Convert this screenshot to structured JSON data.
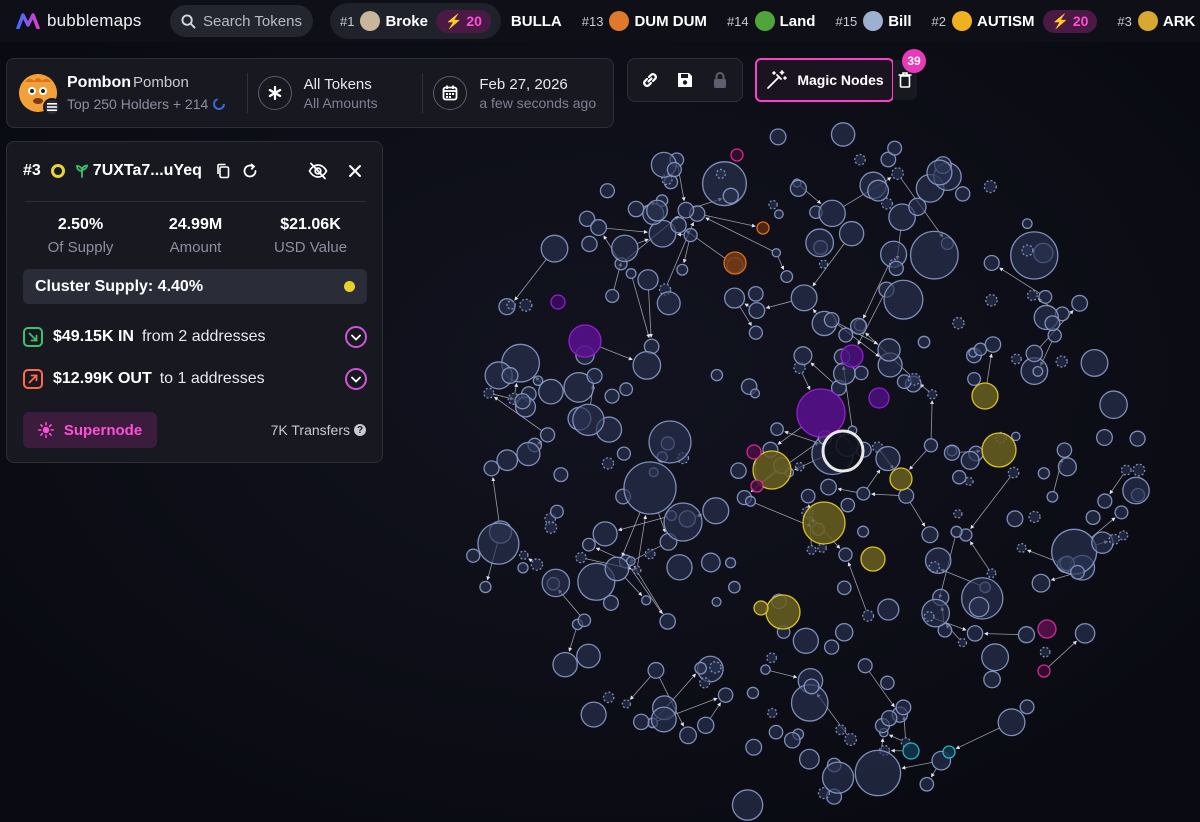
{
  "app": {
    "name": "bubblemaps"
  },
  "search": {
    "label": "Search Tokens"
  },
  "trending": [
    {
      "rank": "#1",
      "name": "Broke",
      "icon": "broke-token-icon",
      "boost": "20",
      "active": true
    },
    {
      "rank": "",
      "name": "BULLA",
      "icon": "",
      "boost": ""
    },
    {
      "rank": "#13",
      "name": "DUM DUM",
      "icon": "dum-dum-token-icon",
      "boost": ""
    },
    {
      "rank": "#14",
      "name": "Land",
      "icon": "land-token-icon",
      "boost": ""
    },
    {
      "rank": "#15",
      "name": "Bill",
      "icon": "bill-token-icon",
      "boost": ""
    },
    {
      "rank": "#2",
      "name": "AUTISM",
      "icon": "autism-token-icon",
      "boost": "20"
    },
    {
      "rank": "#3",
      "name": "ARK",
      "icon": "ark-token-icon",
      "boost": ""
    }
  ],
  "token": {
    "name": "Pombon",
    "symbol": "Pombon",
    "holders_text": "Top 250 Holders + 214",
    "filter_title": "All Tokens",
    "filter_sub": "All Amounts",
    "date": "Feb 27, 2026",
    "date_sub": "a few seconds ago"
  },
  "toolbar": {
    "magic_nodes_label": "Magic Nodes",
    "magic_nodes_count": "39"
  },
  "holder": {
    "rank": "#3",
    "address": "7UXTa7...uYeq",
    "supply_pct": "2.50%",
    "supply_label": "Of Supply",
    "amount": "24.99M",
    "amount_label": "Amount",
    "usd_value": "$21.06K",
    "usd_label": "USD Value",
    "cluster_supply": "Cluster Supply: 4.40%",
    "in_amount": "$49.15K IN",
    "in_text": "from 2 addresses",
    "out_amount": "$12.99K OUT",
    "out_text": "to 1 addresses",
    "supernode_label": "Supernode",
    "transfers": "7K Transfers"
  },
  "colors": {
    "accent": "#ff3fc9",
    "bubble_default": "#8b9bc8",
    "cluster_yellow": "#e9cf2b",
    "cluster_purple": "#a020e0",
    "cluster_magenta": "#e030a0",
    "cluster_orange": "#e87820",
    "cluster_cyan": "#30c0d8"
  }
}
